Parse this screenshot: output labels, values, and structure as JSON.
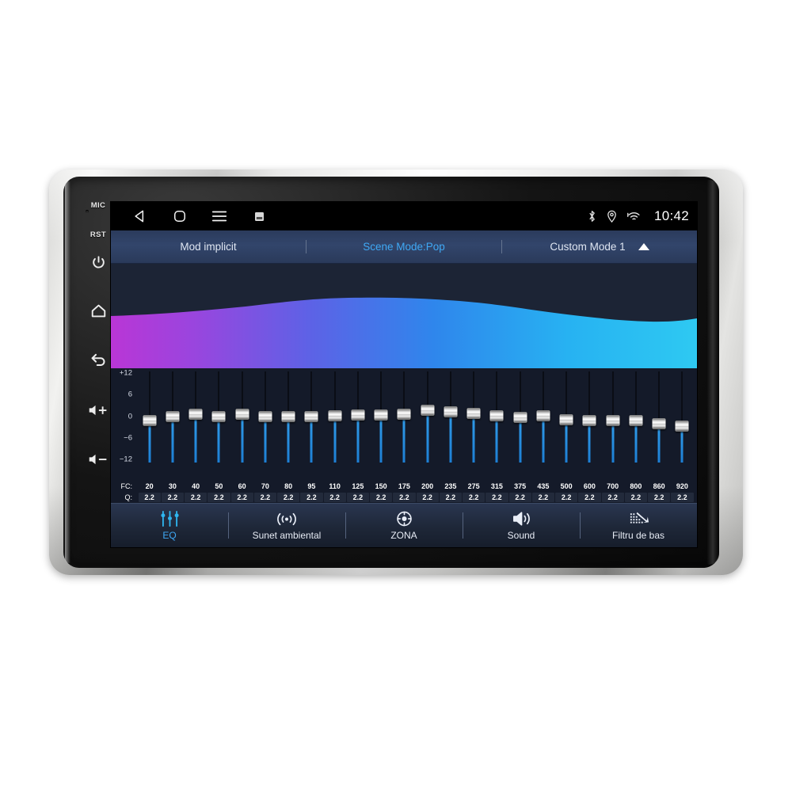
{
  "device": {
    "hardware_buttons": [
      {
        "name": "mic",
        "label": "MIC"
      },
      {
        "name": "reset",
        "label": "RST"
      },
      {
        "name": "power",
        "label": "power-icon"
      },
      {
        "name": "home",
        "label": "home-icon"
      },
      {
        "name": "back",
        "label": "back-icon"
      },
      {
        "name": "volume-up",
        "label": "volume-up-icon"
      },
      {
        "name": "volume-down",
        "label": "volume-down-icon"
      }
    ]
  },
  "statusbar": {
    "nav": [
      {
        "name": "back",
        "icon": "triangle-left-icon"
      },
      {
        "name": "home",
        "icon": "rounded-square-icon"
      },
      {
        "name": "menu",
        "icon": "hamburger-icon"
      },
      {
        "name": "screenshot",
        "icon": "small-square-icon"
      }
    ],
    "tray": [
      {
        "name": "bluetooth",
        "icon": "bluetooth-icon"
      },
      {
        "name": "location",
        "icon": "location-pin-icon"
      },
      {
        "name": "wifi",
        "icon": "wifi-icon"
      }
    ],
    "clock": "10:42"
  },
  "modebar": {
    "left_label": "Mod implicit",
    "center_label": "Scene Mode:Pop",
    "right_label": "Custom Mode 1",
    "expand_icon": "caret-up-icon",
    "active": "center"
  },
  "visualizer": {
    "gradient_start": "#b936d6",
    "gradient_mid": "#3f74e8",
    "gradient_end": "#2ec4f0",
    "background": "#1c2435"
  },
  "equalizer": {
    "y_ticks": [
      "+12",
      "6",
      "0",
      "-6",
      "-12"
    ],
    "y_min": -12,
    "y_max": 12,
    "fc_row_label": "FC:",
    "q_row_label": "Q:",
    "accent_color": "#2f9ae8",
    "bands": [
      {
        "fc": "20",
        "q": "2.2",
        "gain": -1.2
      },
      {
        "fc": "30",
        "q": "2.2",
        "gain": -0.2
      },
      {
        "fc": "40",
        "q": "2.2",
        "gain": 0.6
      },
      {
        "fc": "50",
        "q": "2.2",
        "gain": 0.0
      },
      {
        "fc": "60",
        "q": "2.2",
        "gain": 0.6
      },
      {
        "fc": "70",
        "q": "2.2",
        "gain": 0.0
      },
      {
        "fc": "80",
        "q": "2.2",
        "gain": 0.0
      },
      {
        "fc": "95",
        "q": "2.2",
        "gain": 0.0
      },
      {
        "fc": "110",
        "q": "2.2",
        "gain": 0.2
      },
      {
        "fc": "125",
        "q": "2.2",
        "gain": 0.4
      },
      {
        "fc": "150",
        "q": "2.2",
        "gain": 0.4
      },
      {
        "fc": "175",
        "q": "2.2",
        "gain": 0.5
      },
      {
        "fc": "200",
        "q": "2.2",
        "gain": 1.6
      },
      {
        "fc": "235",
        "q": "2.2",
        "gain": 1.2
      },
      {
        "fc": "275",
        "q": "2.2",
        "gain": 0.8
      },
      {
        "fc": "315",
        "q": "2.2",
        "gain": 0.2
      },
      {
        "fc": "375",
        "q": "2.2",
        "gain": -0.4
      },
      {
        "fc": "435",
        "q": "2.2",
        "gain": 0.2
      },
      {
        "fc": "500",
        "q": "2.2",
        "gain": -1.0
      },
      {
        "fc": "600",
        "q": "2.2",
        "gain": -1.2
      },
      {
        "fc": "700",
        "q": "2.2",
        "gain": -1.2
      },
      {
        "fc": "800",
        "q": "2.2",
        "gain": -1.2
      },
      {
        "fc": "860",
        "q": "2.2",
        "gain": -2.0
      },
      {
        "fc": "920",
        "q": "2.2",
        "gain": -2.8
      }
    ]
  },
  "bottomnav": {
    "items": [
      {
        "label": "EQ",
        "icon": "eq-sliders-icon",
        "active": true
      },
      {
        "label": "Sunet ambiental",
        "icon": "surround-waves-icon",
        "active": false
      },
      {
        "label": "ZONA",
        "icon": "zone-target-icon",
        "active": false
      },
      {
        "label": "Sound",
        "icon": "speaker-icon",
        "active": false
      },
      {
        "label": "Filtru de bas",
        "icon": "bass-filter-icon",
        "active": false
      }
    ]
  }
}
